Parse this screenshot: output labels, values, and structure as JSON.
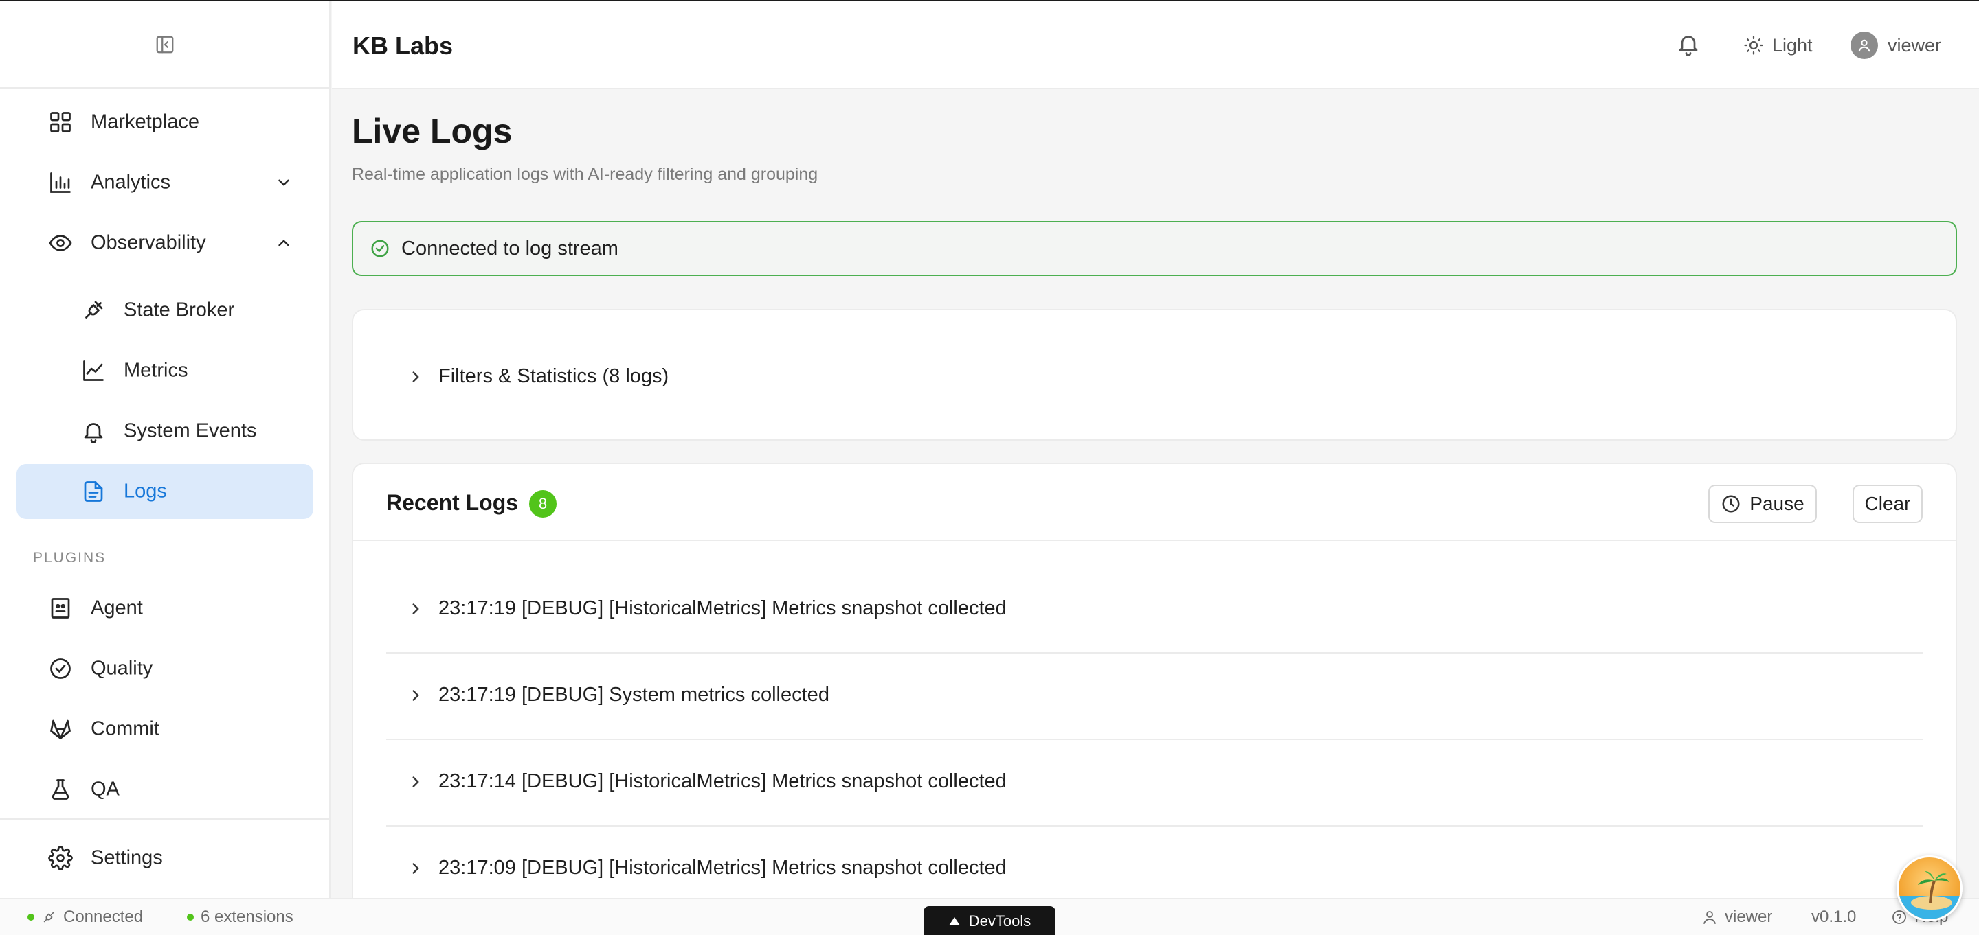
{
  "header": {
    "brand": "KB Labs",
    "theme_label": "Light",
    "user_label": "viewer"
  },
  "sidebar": {
    "items": [
      {
        "label": "Marketplace",
        "icon": "grid-icon"
      },
      {
        "label": "Analytics",
        "icon": "bar-chart-icon"
      },
      {
        "label": "Observability",
        "icon": "eye-icon"
      },
      {
        "label": "State Broker",
        "icon": "plug-icon"
      },
      {
        "label": "Metrics",
        "icon": "line-chart-icon"
      },
      {
        "label": "System Events",
        "icon": "bell-icon"
      },
      {
        "label": "Logs",
        "icon": "file-text-icon"
      }
    ],
    "plugins_heading": "PLUGINS",
    "plugins": [
      {
        "label": "Agent",
        "icon": "robot-icon"
      },
      {
        "label": "Quality",
        "icon": "check-circle-icon"
      },
      {
        "label": "Commit",
        "icon": "gitlab-icon"
      },
      {
        "label": "QA",
        "icon": "flask-icon"
      }
    ],
    "settings_label": "Settings"
  },
  "main": {
    "title": "Live Logs",
    "subtitle": "Real-time application logs with AI-ready filtering and grouping",
    "alert": "Connected to log stream",
    "filters_label": "Filters & Statistics (8 logs)",
    "recent_title": "Recent Logs",
    "recent_count": "8",
    "pause_label": "Pause",
    "clear_label": "Clear",
    "logs": [
      "23:17:19 [DEBUG] [HistoricalMetrics] Metrics snapshot collected",
      "23:17:19 [DEBUG] System metrics collected",
      "23:17:14 [DEBUG] [HistoricalMetrics] Metrics snapshot collected",
      "23:17:09 [DEBUG] [HistoricalMetrics] Metrics snapshot collected"
    ]
  },
  "footer": {
    "connection": "Connected",
    "extensions": "6 extensions",
    "devtools": "DevTools",
    "user": "viewer",
    "version": "v0.1.0",
    "help": "Help"
  },
  "colors": {
    "accent": "#1677d9",
    "active_bg": "#dceafb",
    "success": "#52c41a",
    "alert_border": "#4caf50"
  }
}
